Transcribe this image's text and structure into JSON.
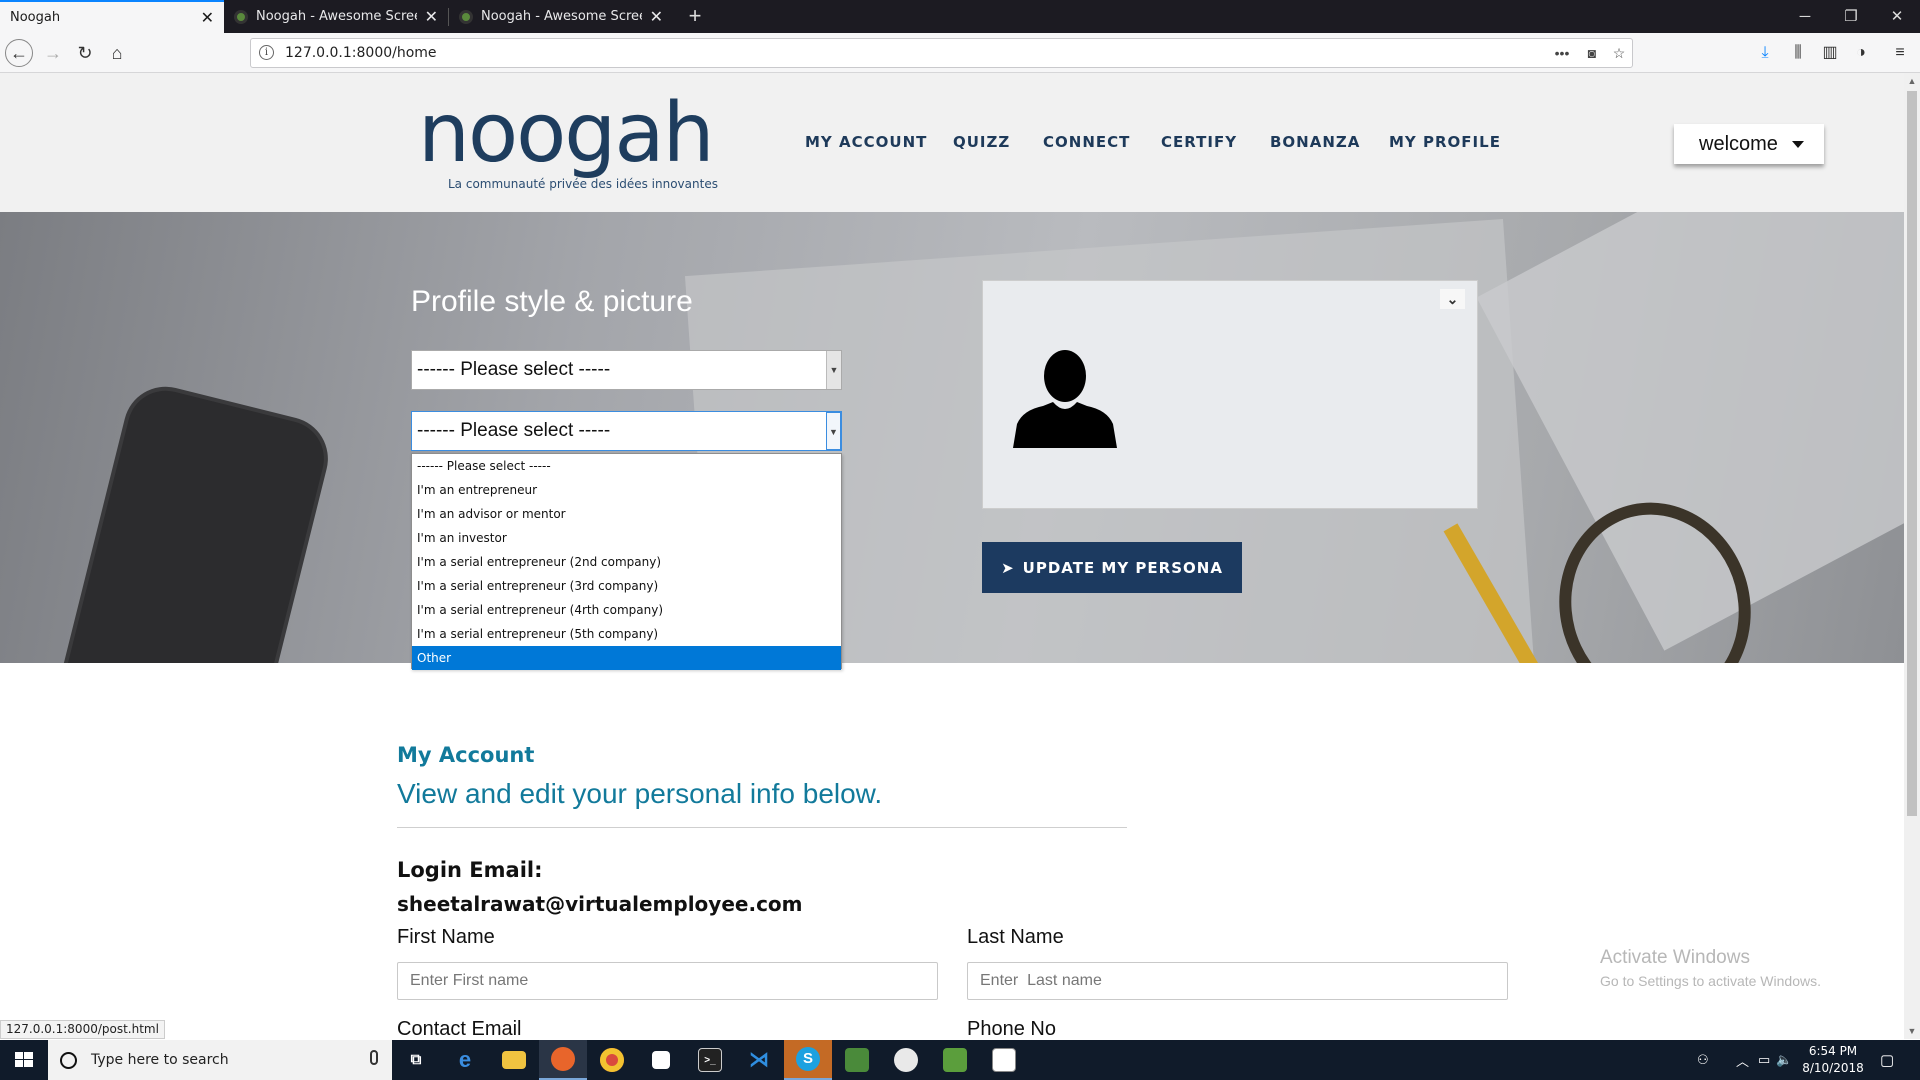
{
  "browser": {
    "tabs": [
      {
        "title": "Noogah",
        "active": true
      },
      {
        "title": "Noogah - Awesome Screen Sho",
        "active": false
      },
      {
        "title": "Noogah - Awesome Screen Sho",
        "active": false
      }
    ],
    "url": "127.0.0.1:8000/home",
    "status_url": "127.0.0.1:8000/post.html"
  },
  "site": {
    "logo": "noogah",
    "tagline": "La communauté privée des idées innovantes",
    "nav": [
      "MY ACCOUNT",
      "QUIZZ",
      "CONNECT",
      "CERTIFY",
      "BONANZA",
      "MY PROFILE"
    ],
    "welcome": "welcome"
  },
  "hero": {
    "title": "Profile style & picture",
    "select1_value": "------ Please select -----",
    "select2_value": "------ Please select -----",
    "dropdown_options": [
      "------ Please select -----",
      "I'm an entrepreneur",
      "I'm an advisor or mentor",
      "I'm an investor",
      "I'm a serial entrepreneur (2nd company)",
      "I'm a serial entrepreneur (3rd company)",
      "I'm a serial entrepreneur (4rth company)",
      "I'm a serial entrepreneur (5th company)",
      "Other"
    ],
    "dropdown_highlighted": "Other",
    "update_button": "UPDATE MY PERSONA"
  },
  "account": {
    "title": "My Account",
    "subtitle": "View and edit your personal info below.",
    "login_label": "Login Email:",
    "login_email": "sheetalrawat@virtualemployee.com",
    "first_name_label": "First Name",
    "first_name_placeholder": "Enter First name",
    "last_name_label": "Last Name",
    "last_name_placeholder": "Enter  Last name",
    "contact_email_label": "Contact Email",
    "phone_label": "Phone No"
  },
  "watermark": {
    "line1": "Activate Windows",
    "line2": "Go to Settings to activate Windows."
  },
  "taskbar": {
    "search_placeholder": "Type here to search",
    "time": "6:54 PM",
    "date": "8/10/2018"
  },
  "colors": {
    "brand_navy": "#1c3a60",
    "accent_teal": "#127a9b",
    "highlight_blue": "#0078d7"
  }
}
